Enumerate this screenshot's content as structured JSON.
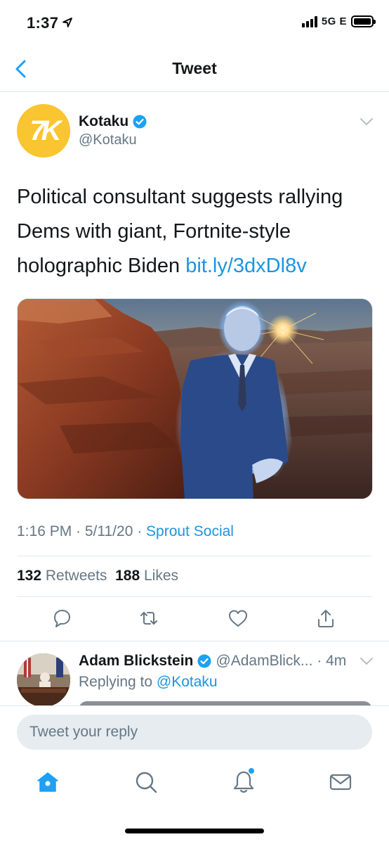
{
  "status_bar": {
    "time": "1:37",
    "network": "5G E"
  },
  "nav": {
    "title": "Tweet"
  },
  "tweet": {
    "avatar_text": "7K",
    "author_name": "Kotaku",
    "author_handle": "@Kotaku",
    "text": "Political consultant suggests rallying Dems with giant, Fortnite-style holographic Biden ",
    "link": "bit.ly/3dxDl8v",
    "timestamp": "1:16 PM · 5/11/20 · ",
    "source": "Sprout Social",
    "retweets_count": "132",
    "retweets_label": " Retweets",
    "likes_count": "188",
    "likes_label": " Likes"
  },
  "reply": {
    "author_name": "Adam Blickstein",
    "author_handle": "@AdamBlick... · 4m",
    "replying_prefix": "Replying to ",
    "replying_to": "@Kotaku"
  },
  "composer": {
    "placeholder": "Tweet your reply"
  },
  "colors": {
    "accent": "#1da1f2",
    "link": "#1b95e0",
    "muted": "#657786",
    "kotaku_yellow": "#f9c530"
  },
  "icons": [
    "location-arrow-icon",
    "back-chevron-icon",
    "verified-badge-icon",
    "chevron-down-icon",
    "reply-icon",
    "retweet-icon",
    "like-icon",
    "share-icon",
    "home-icon",
    "search-icon",
    "notifications-icon",
    "messages-icon"
  ]
}
